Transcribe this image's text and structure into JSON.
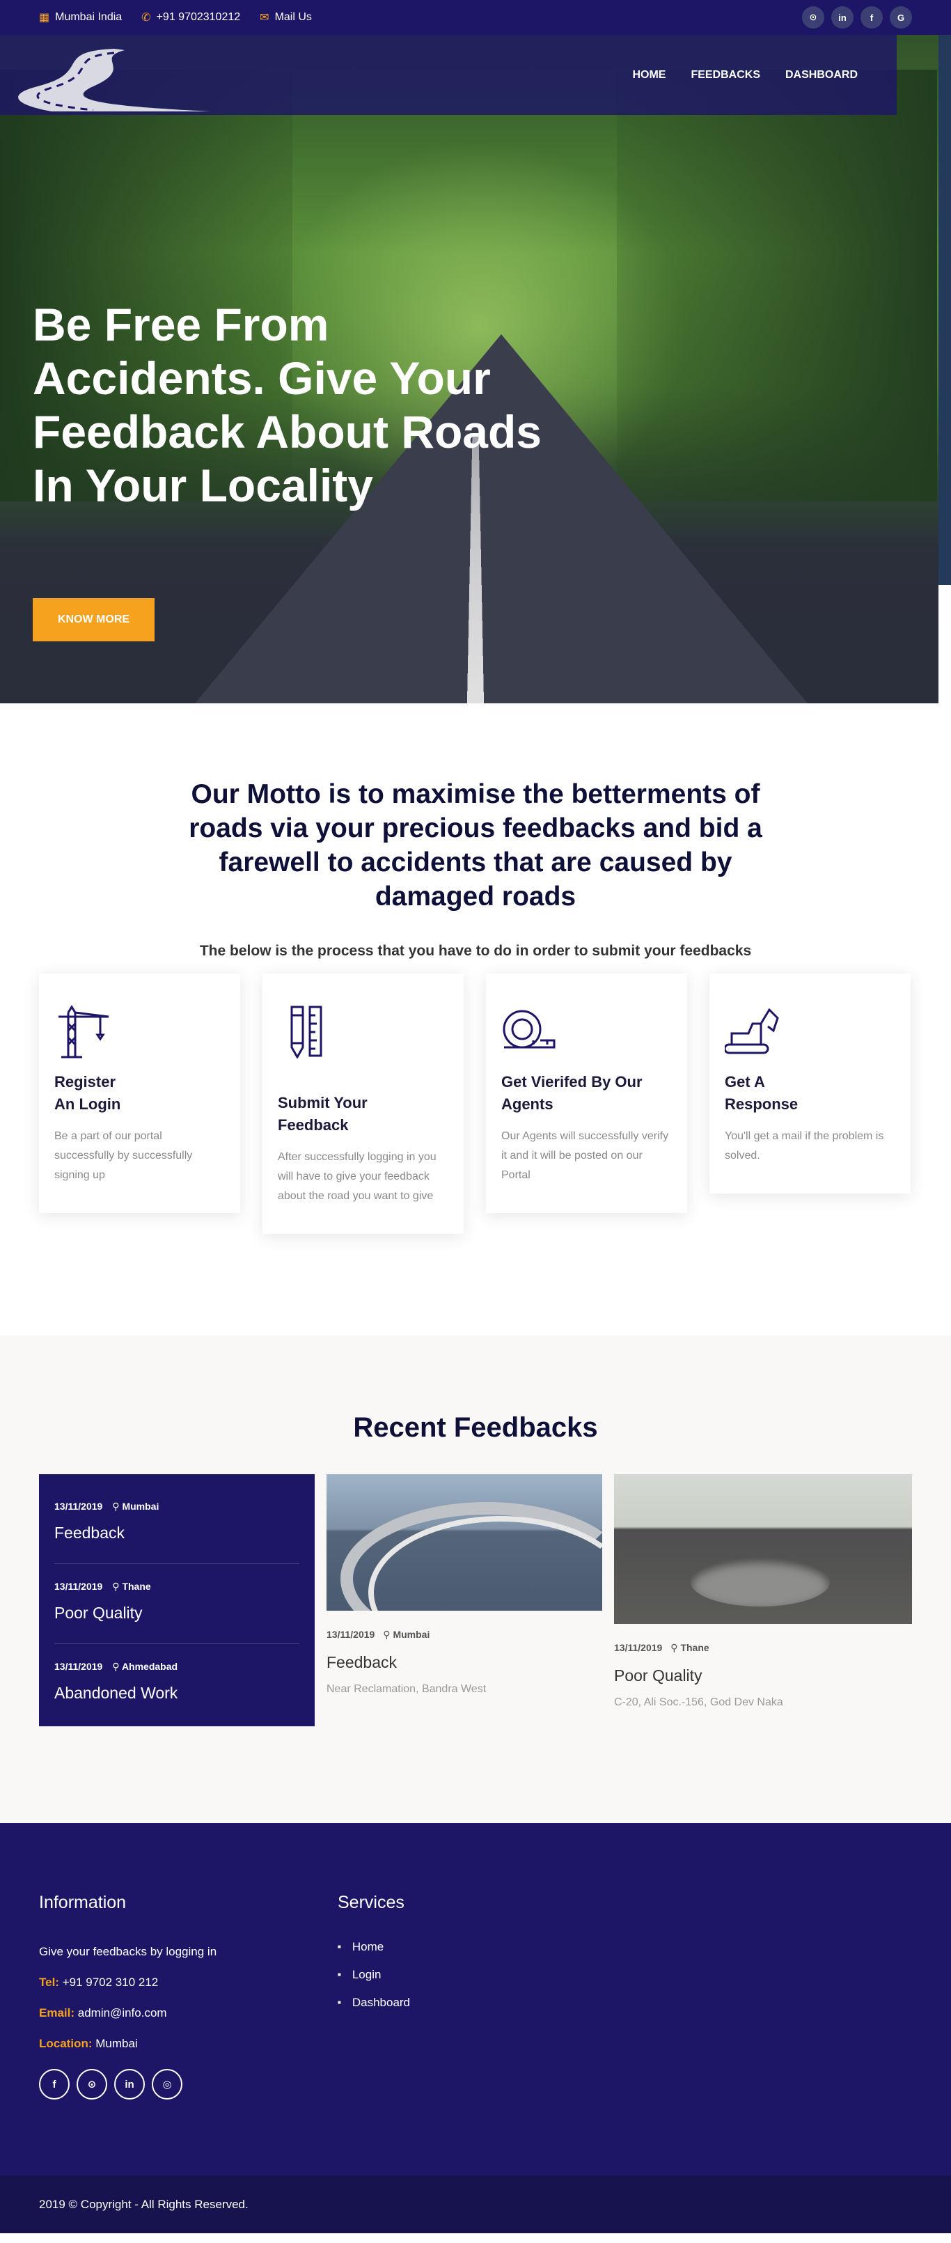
{
  "topbar": {
    "location": "Mumbai India",
    "phone": "+91 9702310212",
    "mail": "Mail Us",
    "social": [
      "⊙",
      "in",
      "f",
      "G"
    ]
  },
  "nav": {
    "home": "HOME",
    "feedbacks": "FEEDBACKS",
    "dashboard": "DASHBOARD"
  },
  "hero": {
    "headline": "Be Free From Accidents. Give Your Feedback About Roads In Your Locality",
    "button": "KNOW MORE"
  },
  "motto": {
    "title": "Our Motto is to maximise the betterments of roads via your precious feedbacks and bid a farewell to accidents that are caused by damaged roads",
    "subtitle": "The below is the process that you have to do in order to submit your feedbacks"
  },
  "steps": [
    {
      "title_line1": "Register",
      "title_line2": "An Login",
      "text": "Be a part of our portal successfully by successfully signing up",
      "icon": "crane-icon"
    },
    {
      "title_line1": "Submit Your",
      "title_line2": "Feedback",
      "text": "After successfully logging in you will have to give your feedback about the road you want to give",
      "icon": "pencil-ruler-icon"
    },
    {
      "title_line1": "Get Vierifed By Our",
      "title_line2": "Agents",
      "text": "Our Agents will successfully verify it and it will be posted on our Portal",
      "icon": "tape-measure-icon"
    },
    {
      "title_line1": "Get A",
      "title_line2": "Response",
      "text": "You'll get a mail if the problem is solved.",
      "icon": "excavator-icon"
    }
  ],
  "feedbacks": {
    "heading": "Recent Feedbacks",
    "list": [
      {
        "date": "13/11/2019",
        "city": "Mumbai",
        "title": "Feedback"
      },
      {
        "date": "13/11/2019",
        "city": "Thane",
        "title": "Poor Quality"
      },
      {
        "date": "13/11/2019",
        "city": "Ahmedabad",
        "title": "Abandoned Work"
      }
    ],
    "cards": [
      {
        "date": "13/11/2019",
        "city": "Mumbai",
        "title": "Feedback",
        "address": "Near Reclamation, Bandra West"
      },
      {
        "date": "13/11/2019",
        "city": "Thane",
        "title": "Poor Quality",
        "address": "C-20, Ali Soc.-156, God Dev Naka"
      }
    ]
  },
  "footer": {
    "info_heading": "Information",
    "info_text": "Give your feedbacks by logging in",
    "tel_label": "Tel:",
    "tel": "+91 9702 310 212",
    "email_label": "Email:",
    "email": "admin@info.com",
    "location_label": "Location:",
    "location": "Mumbai",
    "services_heading": "Services",
    "services": [
      "Home",
      "Login",
      "Dashboard"
    ],
    "social": [
      "f",
      "⊙",
      "in",
      "◎"
    ],
    "copyright": "2019 © Copyright - All Rights Reserved."
  }
}
